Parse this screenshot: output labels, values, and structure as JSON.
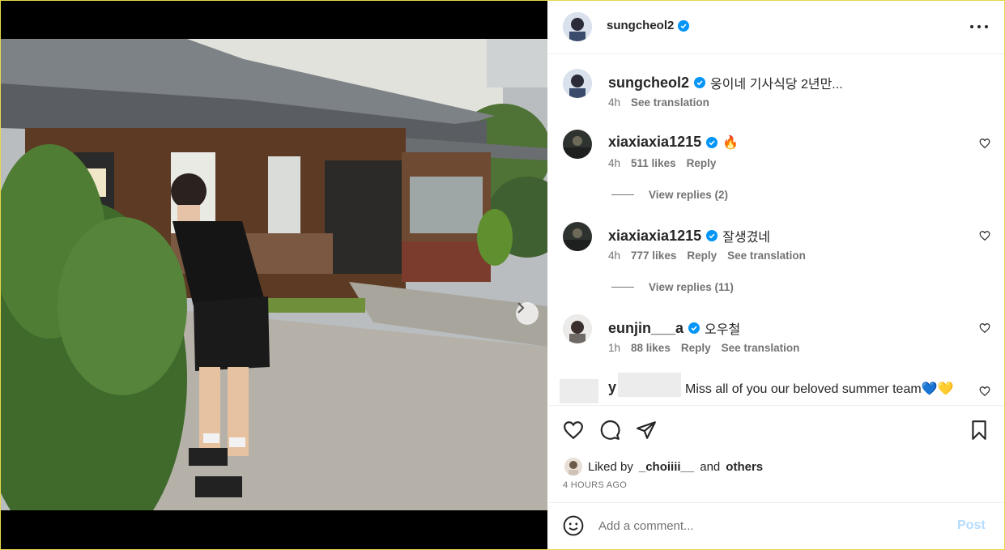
{
  "post": {
    "author": "sungcheol2",
    "caption": "웅이네 기사식당 2년만...",
    "caption_time": "4h",
    "caption_translate": "See translation",
    "more_icon": "more-horizontal-icon"
  },
  "media": {
    "next_icon": "chevron-right-icon",
    "dots_count": 2,
    "active_dot": 0
  },
  "comments": [
    {
      "user": "xiaxiaxia1215",
      "text": "🔥",
      "time": "4h",
      "likes": "511 likes",
      "reply": "Reply",
      "translate": "",
      "view_replies": "View replies (2)"
    },
    {
      "user": "xiaxiaxia1215",
      "text": "잘생겼네",
      "time": "4h",
      "likes": "777 likes",
      "reply": "Reply",
      "translate": "See translation",
      "view_replies": "View replies (11)"
    },
    {
      "user": "eunjin___a",
      "text": "오우철",
      "time": "1h",
      "likes": "88 likes",
      "reply": "Reply",
      "translate": "See translation",
      "view_replies": ""
    }
  ],
  "partial_comment": {
    "user_initial": "y",
    "text": "Miss all of you our beloved summer team💙💛"
  },
  "footer": {
    "liked_by_prefix": "Liked by",
    "liked_by_user": "_choiiii__",
    "liked_by_and": "and",
    "liked_by_others": "others",
    "time_ago": "4 HOURS AGO",
    "comment_placeholder": "Add a comment...",
    "post_label": "Post"
  },
  "colors": {
    "verified": "#0095f6",
    "post_disabled": "#b3dbff",
    "meta": "#737373"
  }
}
